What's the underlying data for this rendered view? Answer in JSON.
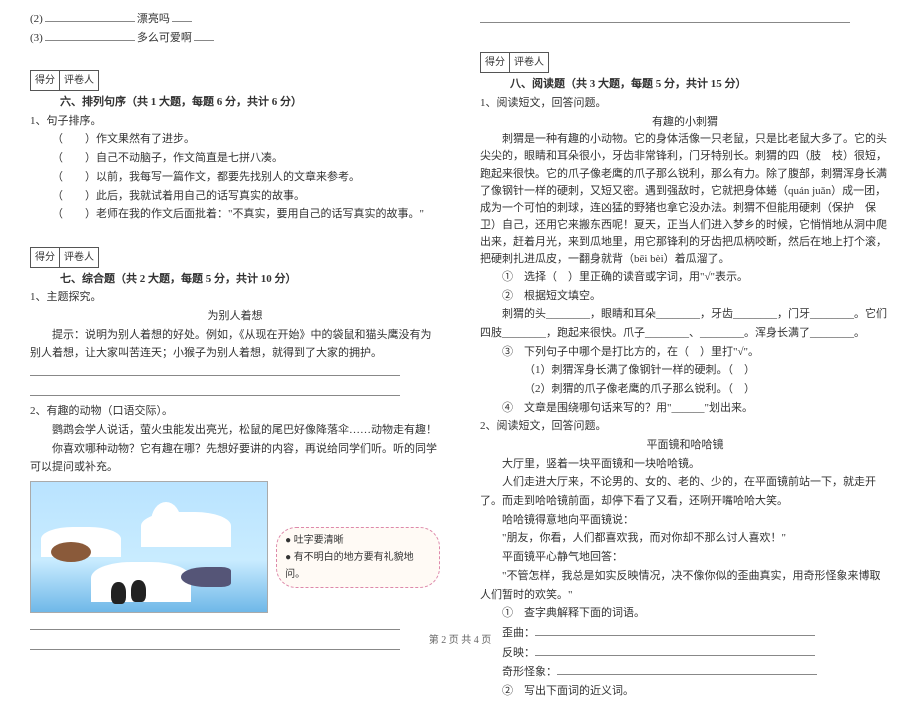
{
  "left": {
    "top_fill": {
      "line2_num": "(2)",
      "line2_tail": "漂亮吗",
      "line3_num": "(3)",
      "line3_tail": "多么可爱啊"
    },
    "score_cells": [
      "得分",
      "评卷人"
    ],
    "sec6_title": "六、排列句序（共 1 大题，每题 6 分，共计 6 分）",
    "sec6_q": "1、句子排序。",
    "sec6_lines": [
      "（　　）作文果然有了进步。",
      "（　　）自己不动脑子，作文简直是七拼八凑。",
      "（　　）以前，我每写一篇作文，都要先找别人的文章来参考。",
      "（　　）此后，我就试着用自己的话写真实的故事。",
      "（　　）老师在我的作文后面批着：\"不真实，要用自己的话写真实的故事。\""
    ],
    "sec7_title": "七、综合题（共 2 大题，每题 5 分，共计 10 分）",
    "sec7_q1_num": "1、主题探究。",
    "sec7_q1_sub": "为别人着想",
    "sec7_q1_hint": "提示：说明为别人着想的好处。例如，《从现在开始》中的袋鼠和猫头鹰没有为别人着想，让大家叫苦连天；小猴子为别人着想，就得到了大家的拥护。",
    "sec7_q2_num": "2、有趣的动物（口语交际）。",
    "sec7_q2_p1": "鹦鹉会学人说话，萤火虫能发出亮光，松鼠的尾巴好像降落伞……动物走有趣！",
    "sec7_q2_p2": "你喜欢哪种动物？它有趣在哪？先想好要讲的内容，再说给同学们听。听的同学可以提问或补充。",
    "bullets": [
      "吐字要清晰",
      "有不明白的地方要有礼貌地问。"
    ]
  },
  "right": {
    "score_cells": [
      "得分",
      "评卷人"
    ],
    "sec8_title": "八、阅读题（共 3 大题，每题 5 分，共计 15 分）",
    "q1_head": "1、阅读短文，回答问题。",
    "q1_title": "有趣的小刺猬",
    "q1_body": "刺猬是一种有趣的小动物。它的身体活像一只老鼠，只是比老鼠大多了。它的头尖尖的，眼睛和耳朵很小，牙齿非常锋利，门牙特别长。刺猬的四（肢　枝）很短，跑起来很快。它的爪子像老鹰的爪子那么锐利，那么有力。除了腹部，刺猬浑身长满了像钢针一样的硬刺，又短又密。遇到强敌时，它就把身体蜷（quán  juǎn）成一团，成为一个可怕的刺球，连凶猛的野猪也拿它没办法。刺猬不但能用硬刺（保护　保卫）自己，还用它来搬东西呢！夏天，正当人们进入梦乡的时候，它悄悄地从洞中爬出来，赶着月光，来到瓜地里，用它那锋利的牙齿把瓜柄咬断，然后在地上打个滚，把硬刺扎进瓜皮，一翻身就背（bēi  bèi）着瓜溜了。",
    "q1_s1": "①　选择（　）里正确的读音或字词，用\"√\"表示。",
    "q1_s2": "②　根据短文填空。",
    "q1_s2_blank": "刺猬的头________，眼睛和耳朵________，牙齿________，门牙________。它们四肢________，跑起来很快。爪子________、________。浑身长满了________。",
    "q1_s3": "③　下列句子中哪个是打比方的，在（　）里打\"√\"。",
    "q1_s3_a": "（1）刺猬浑身长满了像钢针一样的硬刺。（　）",
    "q1_s3_b": "（2）刺猬的爪子像老鹰的爪子那么锐利。（　）",
    "q1_s4": "④　文章是围绕哪句话来写的？用\"______\"划出来。",
    "q2_head": "2、阅读短文，回答问题。",
    "q2_title": "平面镜和哈哈镜",
    "q2_p1": "大厅里，竖着一块平面镜和一块哈哈镜。",
    "q2_p2": "人们走进大厅来，不论男的、女的、老的、少的，在平面镜前站一下，就走开了。而走到哈哈镜前面，却停下看了又看，还咧开嘴哈哈大笑。",
    "q2_p3": "哈哈镜得意地向平面镜说：",
    "q2_p4": "\"朋友，你看，人们都喜欢我，而对你却不那么讨人喜欢！\"",
    "q2_p5": "平面镜平心静气地回答：",
    "q2_p6": "\"不管怎样，我总是如实反映情况，决不像你似的歪曲真实，用奇形怪象来博取人们暂时的欢笑。\"",
    "q2_s1": "①　查字典解释下面的词语。",
    "q2_words": [
      "歪曲：",
      "反映：",
      "奇形怪象："
    ],
    "q2_s2": "②　写出下面词的近义词。"
  },
  "footer": "第 2 页 共 4 页"
}
